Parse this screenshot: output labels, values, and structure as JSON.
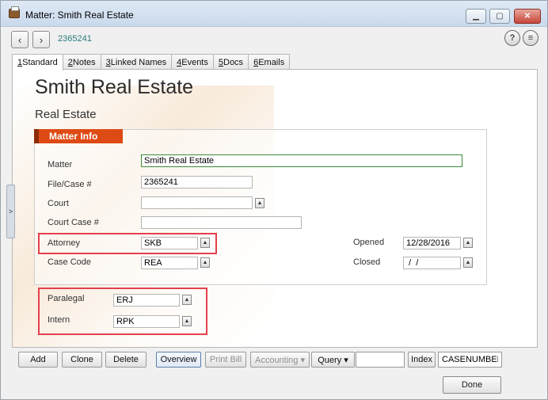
{
  "window": {
    "title": "Matter: Smith Real Estate"
  },
  "nav": {
    "record_id": "2365241",
    "back_icon": "chevron-left-icon",
    "forward_icon": "chevron-right-icon",
    "help_label": "?",
    "menu_label": "≡"
  },
  "tabs": [
    {
      "num": "1",
      "label": " Standard"
    },
    {
      "num": "2",
      "label": " Notes"
    },
    {
      "num": "3",
      "label": " Linked Names"
    },
    {
      "num": "4",
      "label": " Events"
    },
    {
      "num": "5",
      "label": " Docs"
    },
    {
      "num": "6",
      "label": " Emails"
    }
  ],
  "matter": {
    "title": "Smith Real Estate",
    "subtitle": "Real Estate"
  },
  "section": {
    "header": "Matter Info"
  },
  "fields": {
    "matter": {
      "label": "Matter",
      "value": "Smith Real Estate"
    },
    "file_case": {
      "label": "File/Case #",
      "value": "2365241"
    },
    "court": {
      "label": "Court",
      "value": ""
    },
    "court_case": {
      "label": "Court Case #",
      "value": ""
    },
    "attorney": {
      "label": "Attorney",
      "value": "SKB"
    },
    "case_code": {
      "label": "Case Code",
      "value": "REA"
    },
    "opened": {
      "label": "Opened",
      "value": "12/28/2016"
    },
    "closed": {
      "label": "Closed",
      "value": " /  /"
    },
    "paralegal": {
      "label": "Paralegal",
      "value": "ERJ"
    },
    "intern": {
      "label": "Intern",
      "value": "RPK"
    }
  },
  "toolbar": {
    "add": "Add",
    "clone": "Clone",
    "delete": "Delete",
    "overview": "Overview",
    "print_bill": "Print Bill",
    "accounting": "Accounting ▾",
    "query": "Query ▾",
    "query_value": "",
    "index": "Index",
    "index_value": "CASENUMBER",
    "done": "Done"
  },
  "colors": {
    "accent": "#de4a14",
    "highlight": "#e4404c",
    "record_id": "#2a7b7b"
  }
}
